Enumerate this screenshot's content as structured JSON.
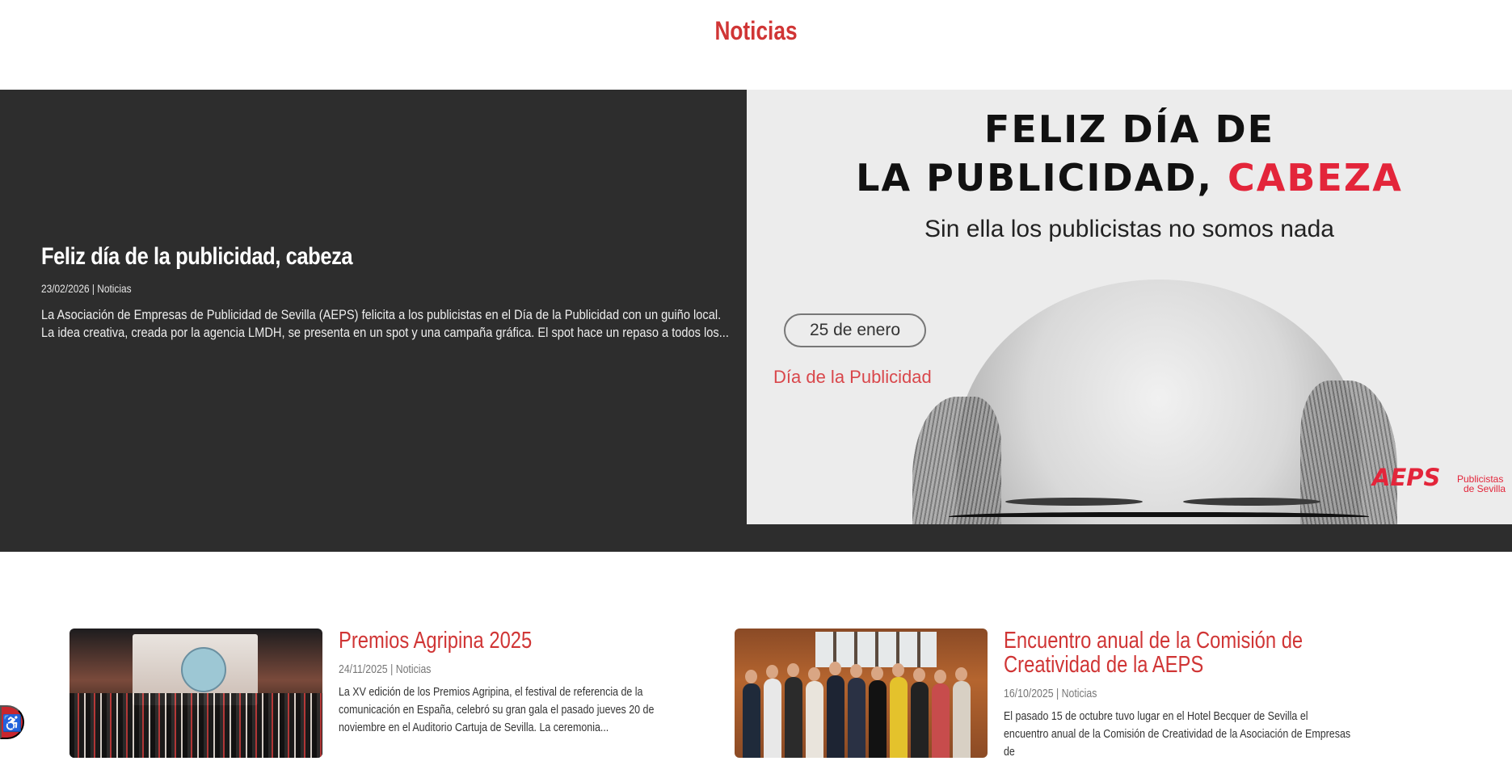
{
  "page": {
    "title": "Noticias"
  },
  "featured": {
    "title": "Feliz día de la publicidad, cabeza",
    "date": "23/02/2026",
    "separator": "|",
    "category": "Noticias",
    "excerpt": "La Asociación de Empresas de Publicidad de Sevilla (AEPS) felicita a los publicistas en el Día de la Publicidad con un guiño local.   La idea creativa, creada por la agencia LMDH, se presenta en un spot y una campaña gráfica. El spot hace un repaso a todos los...",
    "image": {
      "headline_line1": "FELIZ DÍA DE",
      "headline_line2_black": "LA PUBLICIDAD,",
      "headline_line2_red": "CABEZA",
      "subtitle": "Sin ella los publicistas no somos nada",
      "date_pill": "25 de enero",
      "day_label": "Día de la Publicidad",
      "logo": "AEPS",
      "logo_tagline_1": "Publicistas",
      "logo_tagline_2": "de Sevilla"
    }
  },
  "cards": [
    {
      "title": "Premios Agripina 2025",
      "date": "24/11/2025",
      "separator": "|",
      "category": "Noticias",
      "excerpt": "La XV edición de los Premios Agripina, el festival de referencia de la comunicación en España, celebró su gran gala el pasado jueves 20 de noviembre en el Auditorio Cartuja de Sevilla. La ceremonia..."
    },
    {
      "title": "Encuentro anual de la Comisión de Creatividad de la AEPS",
      "date": "16/10/2025",
      "separator": "|",
      "category": "Noticias",
      "excerpt": "El pasado 15 de octubre tuvo lugar en el Hotel Becquer de Sevilla el encuentro anual de la Comisión de Creatividad de la Asociación de Empresas de"
    }
  ],
  "accessibility_button": {
    "icon": "accessibility-icon"
  },
  "colors": {
    "accent": "#d03535",
    "hero_bg": "#2d2d2d",
    "brand_red": "#e3253a"
  }
}
